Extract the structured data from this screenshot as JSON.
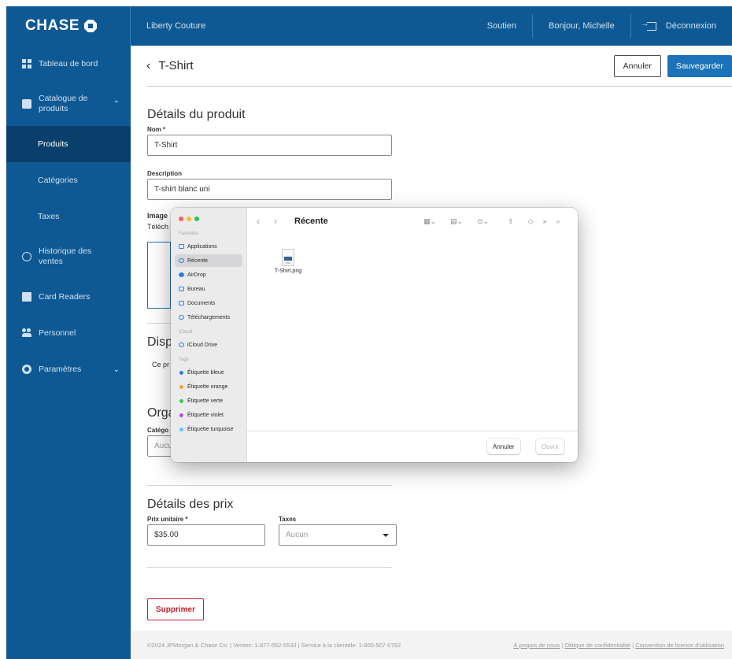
{
  "topbar": {
    "logo": "CHASE",
    "brand": "Liberty Couture",
    "support": "Soutien",
    "greeting": "Bonjour, Michelle",
    "logout": "Déconnexion"
  },
  "sidebar": {
    "items": [
      {
        "label": "Tableau de bord",
        "icon": "dashboard-icon"
      },
      {
        "label": "Catalogue de produits",
        "icon": "box-icon"
      },
      {
        "label": "Produits"
      },
      {
        "label": "Catégories"
      },
      {
        "label": "Taxes"
      },
      {
        "label": "Historique des ventes",
        "icon": "history-icon"
      },
      {
        "label": "Card Readers",
        "icon": "calculator-icon"
      },
      {
        "label": "Personnel",
        "icon": "people-icon"
      },
      {
        "label": "Paramètres",
        "icon": "gear-icon"
      }
    ]
  },
  "header": {
    "title": "T-Shirt",
    "cancel": "Annuler",
    "save": "Sauvegarder"
  },
  "form": {
    "details_title": "Détails du produit",
    "name_label": "Nom *",
    "name_value": "T-Shirt",
    "description_label": "Description",
    "description_value": "T-shirt blanc uni",
    "image_label": "Image",
    "image_hint": "Téléch",
    "dispo_title": "Disp",
    "dispo_text": "Ce pr",
    "org_title": "Orga",
    "category_label": "Catégo",
    "category_value": "Aucu",
    "price_title": "Détails des prix",
    "unit_price_label": "Prix unitaire *",
    "unit_price_value": "$35.00",
    "tax_label": "Taxes",
    "tax_value": "Aucun",
    "delete": "Supprimer"
  },
  "footer": {
    "left": "©2024 JPMorgan & Chase Co. | Ventes: 1-877-552-5533 | Service à la clientèle: 1-800-507-0782",
    "right_1": "À propos de nous",
    "right_2": "Olitique de confidentialité",
    "right_3": "Convention de licence d'utilisation"
  },
  "dialog": {
    "title": "Récente",
    "favorites_label": "Favorites",
    "favorites": [
      "Applications",
      "Récente",
      "AirDrop",
      "Bureau",
      "Documents",
      "Téléchargements"
    ],
    "icloud_label": "iCloud",
    "icloud": [
      "iCloud Drive"
    ],
    "tags_label": "Tags",
    "tags": [
      {
        "label": "Étiquette bleue",
        "color": "#2f7de1"
      },
      {
        "label": "Étiquette orange",
        "color": "#f5a623"
      },
      {
        "label": "Étiquette verte",
        "color": "#34c759"
      },
      {
        "label": "Étiquette violet",
        "color": "#af52de"
      },
      {
        "label": "Étiquette turquoise",
        "color": "#5ac8fa"
      }
    ],
    "file_name": "T-Shirt.png",
    "cancel": "Annuler",
    "open": "Ouvrir"
  },
  "colors": {
    "brand_blue": "#0e5994",
    "active_nav": "#0a3f6b",
    "primary_button": "#1c72b8",
    "danger": "#c8202a"
  }
}
